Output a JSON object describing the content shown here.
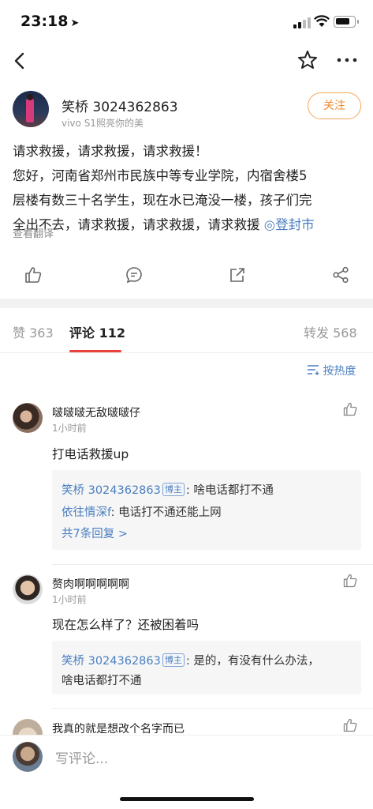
{
  "status_bar": {
    "time": "23:18",
    "location_arrow": "location-arrow-icon"
  },
  "nav": {
    "back_icon": "chevron-left-icon",
    "favorite_icon": "star-icon",
    "more_icon": "more-dots-icon"
  },
  "post": {
    "author": "笑桥 3024362863",
    "device": "vivo S1照亮你的美",
    "follow_label": "关注",
    "lines": [
      "请求救援，请求救援，请求救援！",
      "您好，河南省郑州市民族中等专业学院，内宿舍楼5",
      "层楼有数三十名学生，现在水已淹没一楼，孩子们完",
      "全出不去，请求救援，请求救援，请求救援 "
    ],
    "location_tag": "◎登封市",
    "translate": "查看翻译"
  },
  "actions": [
    "like-icon",
    "comment-icon",
    "share-icon",
    "share-network-icon"
  ],
  "tabs": {
    "likes": "赞 363",
    "comments": "评论 112",
    "reposts": "转发 568"
  },
  "sort_label": "按热度",
  "comments": [
    {
      "name": "啵啵啵无敌啵啵仔",
      "time": "1小时前",
      "text": "打电话救援up",
      "replies": [
        {
          "name": "笑桥 3024362863",
          "badge": "博主",
          "text": ": 啥电话都打不通"
        },
        {
          "name": "依往情深f",
          "badge": "",
          "text": ": 电话打不通还能上网"
        }
      ],
      "more_replies": "共7条回复 >"
    },
    {
      "name": "赘肉啊啊啊啊啊",
      "time": "1小时前",
      "text": "现在怎么样了？还被困着吗",
      "replies": [
        {
          "name": "笑桥 3024362863",
          "badge": "博主",
          "text": ": 是的，有没有什么办法，",
          "text2": "啥电话都打不通"
        }
      ]
    },
    {
      "name": "我真的就是想改个名字而已"
    }
  ],
  "input_placeholder": "写评论..."
}
